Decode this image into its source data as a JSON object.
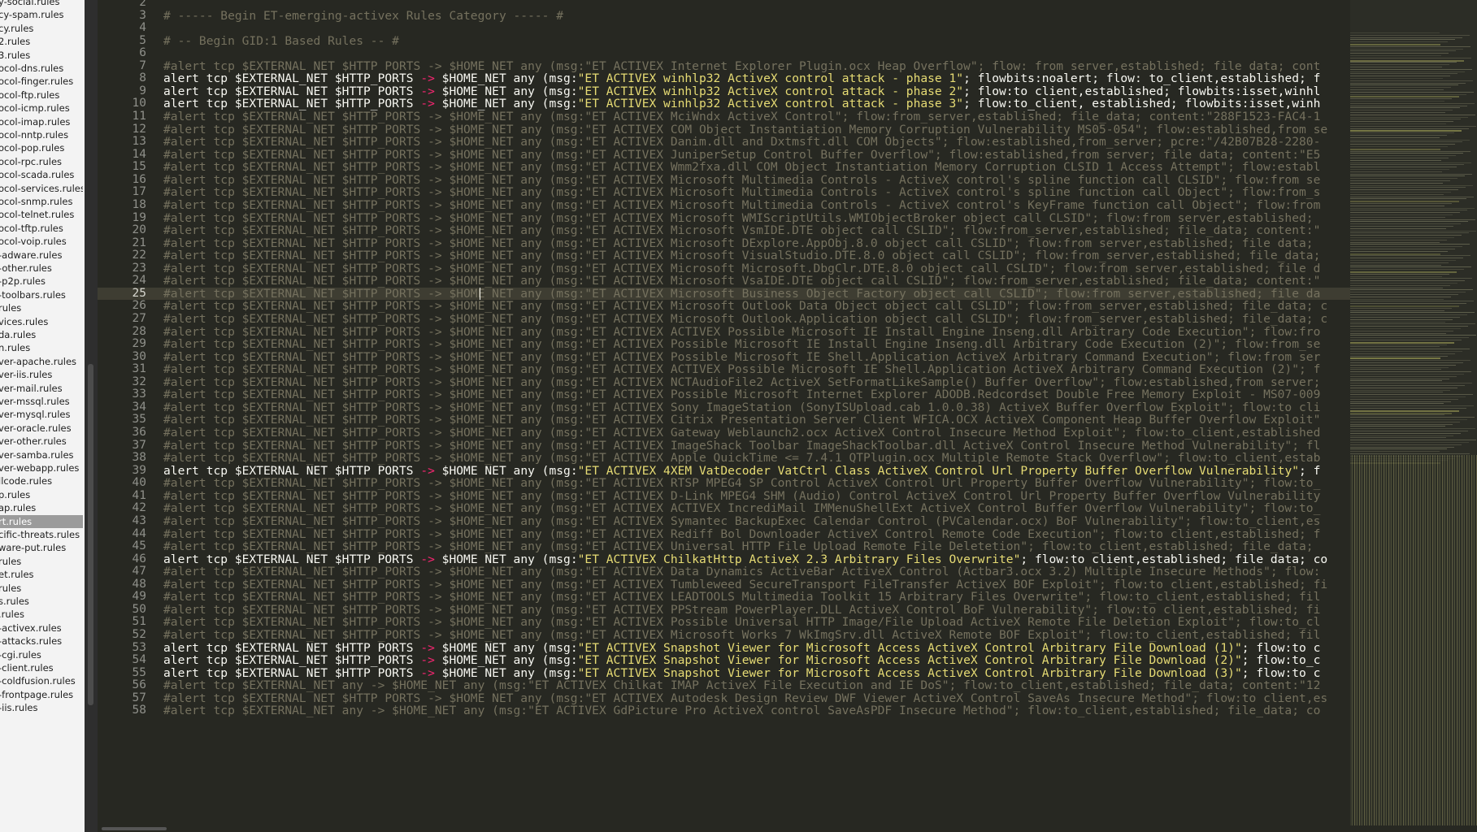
{
  "sidebar": {
    "items": [
      {
        "label": "y-social.rules"
      },
      {
        "label": "cy-spam.rules"
      },
      {
        "label": "cy.rules"
      },
      {
        "label": "2.rules"
      },
      {
        "label": "3.rules"
      },
      {
        "label": "ocol-dns.rules"
      },
      {
        "label": "ocol-finger.rules"
      },
      {
        "label": "ocol-ftp.rules"
      },
      {
        "label": "ocol-icmp.rules"
      },
      {
        "label": "ocol-imap.rules"
      },
      {
        "label": "ocol-nntp.rules"
      },
      {
        "label": "ocol-pop.rules"
      },
      {
        "label": "ocol-rpc.rules"
      },
      {
        "label": "ocol-scada.rules"
      },
      {
        "label": "ocol-services.rules"
      },
      {
        "label": "ocol-snmp.rules"
      },
      {
        "label": "ocol-telnet.rules"
      },
      {
        "label": "ocol-tftp.rules"
      },
      {
        "label": "ocol-voip.rules"
      },
      {
        "label": "-adware.rules"
      },
      {
        "label": "-other.rules"
      },
      {
        "label": "-p2p.rules"
      },
      {
        "label": "-toolbars.rules"
      },
      {
        "label": "rules"
      },
      {
        "label": "vices.rules"
      },
      {
        "label": "da.rules"
      },
      {
        "label": "n.rules"
      },
      {
        "label": "ver-apache.rules"
      },
      {
        "label": "ver-iis.rules"
      },
      {
        "label": "ver-mail.rules"
      },
      {
        "label": "ver-mssql.rules"
      },
      {
        "label": "ver-mysql.rules"
      },
      {
        "label": "ver-oracle.rules"
      },
      {
        "label": "ver-other.rules"
      },
      {
        "label": "ver-samba.rules"
      },
      {
        "label": "ver-webapp.rules"
      },
      {
        "label": "llcode.rules"
      },
      {
        "label": "p.rules"
      },
      {
        "label": "ap.rules"
      },
      {
        "label": "rt.rules",
        "selected": true
      },
      {
        "label": "cific-threats.rules"
      },
      {
        "label": "ware-put.rules"
      },
      {
        "label": "rules"
      },
      {
        "label": "et.rules"
      },
      {
        "label": "rules"
      },
      {
        "label": "s.rules"
      },
      {
        "label": ".rules"
      },
      {
        "label": "-activex.rules"
      },
      {
        "label": "-attacks.rules"
      },
      {
        "label": "-cgi.rules"
      },
      {
        "label": "-client.rules"
      },
      {
        "label": "-coldfusion.rules"
      },
      {
        "label": "-frontpage.rules"
      },
      {
        "label": "-iis.rules"
      }
    ]
  },
  "editor": {
    "active_line": 25,
    "lines": [
      {
        "n": "2",
        "text": "",
        "type": "comment"
      },
      {
        "n": "3",
        "text": "# ----- Begin ET-emerging-activex Rules Category ----- #",
        "type": "comment"
      },
      {
        "n": "4",
        "text": "",
        "type": "comment"
      },
      {
        "n": "5",
        "text": "# -- Begin GID:1 Based Rules -- #",
        "type": "comment"
      },
      {
        "n": "6",
        "text": "",
        "type": "comment"
      },
      {
        "n": "7",
        "text": "#alert tcp $EXTERNAL_NET $HTTP_PORTS -> $HOME_NET any (msg:\"ET ACTIVEX Internet Explorer Plugin.ocx Heap Overflow\"; flow: from_server,established; file_data; cont",
        "type": "comment"
      },
      {
        "n": "8",
        "pre": "alert tcp $EXTERNAL_NET $HTTP_PORTS ",
        "arrow": "->",
        "mid": " $HOME_NET any (msg:",
        "msg": "\"ET ACTIVEX winhlp32 ActiveX control attack - phase 1\"",
        "post": "; flowbits:noalert; flow: to_client,established; f",
        "type": "active"
      },
      {
        "n": "9",
        "pre": "alert tcp $EXTERNAL_NET $HTTP_PORTS ",
        "arrow": "->",
        "mid": " $HOME_NET any (msg:",
        "msg": "\"ET ACTIVEX winhlp32 ActiveX control attack - phase 2\"",
        "post": "; flow:to_client,established; flowbits:isset,winhl",
        "type": "active"
      },
      {
        "n": "10",
        "pre": "alert tcp $EXTERNAL_NET $HTTP_PORTS ",
        "arrow": "->",
        "mid": " $HOME_NET any (msg:",
        "msg": "\"ET ACTIVEX winhlp32 ActiveX control attack - phase 3\"",
        "post": "; flow:to_client, established; flowbits:isset,winh",
        "type": "active"
      },
      {
        "n": "11",
        "text": "#alert tcp $EXTERNAL_NET $HTTP_PORTS -> $HOME_NET any (msg:\"ET ACTIVEX MciWndx ActiveX Control\"; flow:from_server,established; file_data; content:\"288F1523-FAC4-1",
        "type": "comment"
      },
      {
        "n": "12",
        "text": "#alert tcp $EXTERNAL_NET $HTTP_PORTS -> $HOME_NET any (msg:\"ET ACTIVEX COM Object Instantiation Memory Corruption Vulnerability MS05-054\"; flow:established,from_se",
        "type": "comment"
      },
      {
        "n": "13",
        "text": "#alert tcp $EXTERNAL_NET $HTTP_PORTS -> $HOME_NET any (msg:\"ET ACTIVEX Danim.dll and Dxtmsft.dll COM Objects\"; flow:established,from_server; pcre:\"/42B07B28-2280-",
        "type": "comment"
      },
      {
        "n": "14",
        "text": "#alert tcp $EXTERNAL_NET $HTTP_PORTS -> $HOME_NET any (msg:\"ET ACTIVEX JuniperSetup Control Buffer Overflow\"; flow:established,from_server; file_data; content:\"E5",
        "type": "comment"
      },
      {
        "n": "15",
        "text": "#alert tcp $EXTERNAL_NET $HTTP_PORTS -> $HOME_NET any (msg:\"ET ACTIVEX Wmm2fxa.dll COM Object Instantiation Memory Corruption CLSID 1 Access Attempt\"; flow:establ",
        "type": "comment"
      },
      {
        "n": "16",
        "text": "#alert tcp $EXTERNAL_NET $HTTP_PORTS -> $HOME_NET any (msg:\"ET ACTIVEX Microsoft Multimedia Controls - ActiveX control's spline function call CLSID\"; flow:from_se",
        "type": "comment"
      },
      {
        "n": "17",
        "text": "#alert tcp $EXTERNAL_NET $HTTP_PORTS -> $HOME_NET any (msg:\"ET ACTIVEX Microsoft Multimedia Controls - ActiveX control's spline function call Object\"; flow:from_s",
        "type": "comment"
      },
      {
        "n": "18",
        "text": "#alert tcp $EXTERNAL_NET $HTTP_PORTS -> $HOME_NET any (msg:\"ET ACTIVEX Microsoft Multimedia Controls - ActiveX control's KeyFrame function call Object\"; flow:from",
        "type": "comment"
      },
      {
        "n": "19",
        "text": "#alert tcp $EXTERNAL_NET $HTTP_PORTS -> $HOME_NET any (msg:\"ET ACTIVEX Microsoft WMIScriptUtils.WMIObjectBroker object call CLSID\"; flow:from_server,established; ",
        "type": "comment"
      },
      {
        "n": "20",
        "text": "#alert tcp $EXTERNAL_NET $HTTP_PORTS -> $HOME_NET any (msg:\"ET ACTIVEX Microsoft VsmIDE.DTE object call CSLID\"; flow:from_server,established; file_data; content:\"",
        "type": "comment"
      },
      {
        "n": "21",
        "text": "#alert tcp $EXTERNAL_NET $HTTP_PORTS -> $HOME_NET any (msg:\"ET ACTIVEX Microsoft DExplore.AppObj.8.0 object call CSLID\"; flow:from_server,established; file_data;",
        "type": "comment"
      },
      {
        "n": "22",
        "text": "#alert tcp $EXTERNAL_NET $HTTP_PORTS -> $HOME_NET any (msg:\"ET ACTIVEX Microsoft VisualStudio.DTE.8.0 object call CSLID\"; flow:from_server,established; file_data;",
        "type": "comment"
      },
      {
        "n": "23",
        "text": "#alert tcp $EXTERNAL_NET $HTTP_PORTS -> $HOME_NET any (msg:\"ET ACTIVEX Microsoft Microsoft.DbgClr.DTE.8.0 object call CSLID\"; flow:from_server,established; file_d",
        "type": "comment"
      },
      {
        "n": "24",
        "text": "#alert tcp $EXTERNAL_NET $HTTP_PORTS -> $HOME_NET any (msg:\"ET ACTIVEX Microsoft VsaIDE.DTE object call CSLID\"; flow:from_server,established; file_data; content:\"",
        "type": "comment"
      },
      {
        "n": "25",
        "text": "#alert tcp $EXTERNAL_NET $HTTP_PORTS -> $HOME_NET any (msg:\"ET ACTIVEX Microsoft Business Object Factory object call CSLID\"; flow:from_server,established; file_da",
        "type": "comment"
      },
      {
        "n": "26",
        "text": "#alert tcp $EXTERNAL_NET $HTTP_PORTS -> $HOME_NET any (msg:\"ET ACTIVEX Microsoft Outlook Data Object object call CSLID\"; flow:from_server,established; file_data; c",
        "type": "comment"
      },
      {
        "n": "27",
        "text": "#alert tcp $EXTERNAL_NET $HTTP_PORTS -> $HOME_NET any (msg:\"ET ACTIVEX Microsoft Outlook.Application object call CSLID\"; flow:from_server,established; file_data; c",
        "type": "comment"
      },
      {
        "n": "28",
        "text": "#alert tcp $EXTERNAL_NET $HTTP_PORTS -> $HOME_NET any (msg:\"ET ACTIVEX ACTIVEX Possible Microsoft IE Install Engine Inseng.dll Arbitrary Code Execution\"; flow:fro",
        "type": "comment"
      },
      {
        "n": "29",
        "text": "#alert tcp $EXTERNAL_NET $HTTP_PORTS -> $HOME_NET any (msg:\"ET ACTIVEX Possible Microsoft IE Install Engine Inseng.dll Arbitrary Code Execution (2)\"; flow:from_se",
        "type": "comment"
      },
      {
        "n": "30",
        "text": "#alert tcp $EXTERNAL_NET $HTTP_PORTS -> $HOME_NET any (msg:\"ET ACTIVEX Possible Microsoft IE Shell.Application ActiveX Arbitrary Command Execution\"; flow:from_ser",
        "type": "comment"
      },
      {
        "n": "31",
        "text": "#alert tcp $EXTERNAL_NET $HTTP_PORTS -> $HOME_NET any (msg:\"ET ACTIVEX ACTIVEX Possible Microsoft IE Shell.Application ActiveX Arbitrary Command Execution (2)\"; f",
        "type": "comment"
      },
      {
        "n": "32",
        "text": "#alert tcp $EXTERNAL_NET $HTTP_PORTS -> $HOME_NET any (msg:\"ET ACTIVEX NCTAudioFile2 ActiveX SetFormatLikeSample() Buffer Overflow\"; flow:established,from_server; ",
        "type": "comment"
      },
      {
        "n": "33",
        "text": "#alert tcp $EXTERNAL_NET $HTTP_PORTS -> $HOME_NET any (msg:\"ET ACTIVEX Possible Microsoft Internet Explorer ADODB.Redcordset Double Free Memory Exploit - MS07-009",
        "type": "comment"
      },
      {
        "n": "34",
        "text": "#alert tcp $EXTERNAL_NET $HTTP_PORTS -> $HOME_NET any (msg:\"ET ACTIVEX Sony ImageStation (SonyISUpload.cab 1.0.0.38) ActiveX Buffer Overflow Exploit\"; flow:to_cli",
        "type": "comment"
      },
      {
        "n": "35",
        "text": "#alert tcp $EXTERNAL_NET $HTTP_PORTS -> $HOME_NET any (msg:\"ET ACTIVEX Citrix Presentation Server Client WFICA.OCX ActiveX Component Heap Buffer Overflow Exploit\"",
        "type": "comment"
      },
      {
        "n": "36",
        "text": "#alert tcp $EXTERNAL_NET $HTTP_PORTS -> $HOME_NET any (msg:\"ET ACTIVEX Gateway Weblaunch2.ocx ActiveX Control Insecure Method Exploit\"; flow:to_client,established",
        "type": "comment"
      },
      {
        "n": "37",
        "text": "#alert tcp $EXTERNAL_NET $HTTP_PORTS -> $HOME_NET any (msg:\"ET ACTIVEX ImageShack Toolbar ImageShackToolbar.dll ActiveX Control Insecure Method Vulnerability\"; fl",
        "type": "comment"
      },
      {
        "n": "38",
        "text": "#alert tcp $EXTERNAL_NET $HTTP_PORTS -> $HOME_NET any (msg:\"ET ACTIVEX Apple QuickTime <= 7.4.1 QTPlugin.ocx Multiple Remote Stack Overflow\"; flow:to_client,estab",
        "type": "comment"
      },
      {
        "n": "39",
        "pre": "alert tcp $EXTERNAL_NET $HTTP_PORTS ",
        "arrow": "->",
        "mid": " $HOME_NET any (msg:",
        "msg": "\"ET ACTIVEX 4XEM VatDecoder VatCtrl Class ActiveX Control Url Property Buffer Overflow Vulnerability\"",
        "post": "; f",
        "type": "active"
      },
      {
        "n": "40",
        "text": "#alert tcp $EXTERNAL_NET $HTTP_PORTS -> $HOME_NET any (msg:\"ET ACTIVEX RTSP MPEG4 SP Control ActiveX Control Url Property Buffer Overflow Vulnerability\"; flow:to_",
        "type": "comment"
      },
      {
        "n": "41",
        "text": "#alert tcp $EXTERNAL_NET $HTTP_PORTS -> $HOME_NET any (msg:\"ET ACTIVEX D-Link MPEG4 SHM (Audio) Control ActiveX Control Url Property Buffer Overflow Vulnerability",
        "type": "comment"
      },
      {
        "n": "42",
        "text": "#alert tcp $EXTERNAL_NET $HTTP_PORTS -> $HOME_NET any (msg:\"ET ACTIVEX ACTIVEX IncrediMail IMMenuShellExt ActiveX Control Buffer Overflow Vulnerability\"; flow:to_",
        "type": "comment"
      },
      {
        "n": "43",
        "text": "#alert tcp $EXTERNAL_NET $HTTP_PORTS -> $HOME_NET any (msg:\"ET ACTIVEX Symantec BackupExec Calendar Control (PVCalendar.ocx) BoF Vulnerability\"; flow:to_client,es",
        "type": "comment"
      },
      {
        "n": "44",
        "text": "#alert tcp $EXTERNAL_NET $HTTP_PORTS -> $HOME_NET any (msg:\"ET ACTIVEX Rediff Bol Downloader ActiveX Control Remote Code Execution\"; flow:to_client,established; f",
        "type": "comment"
      },
      {
        "n": "45",
        "text": "#alert tcp $EXTERNAL_NET $HTTP_PORTS -> $HOME_NET any (msg:\"ET ACTIVEX Universal HTTP File Upload Remote File Deletetion\"; flow:to_client,established; file_data; ",
        "type": "comment"
      },
      {
        "n": "46",
        "pre": "alert tcp $EXTERNAL_NET $HTTP_PORTS ",
        "arrow": "->",
        "mid": " $HOME_NET any (msg:",
        "msg": "\"ET ACTIVEX ChilkatHttp ActiveX 2.3 Arbitrary Files Overwrite\"",
        "post": "; flow:to_client,established; file_data; co",
        "type": "active"
      },
      {
        "n": "47",
        "text": "#alert tcp $EXTERNAL_NET $HTTP_PORTS -> $HOME_NET any (msg:\"ET ACTIVEX Data Dynamics ActiveBar ActiveX Control (Actbar3.ocx 3.2) Multiple Insecure Methods\"; flow:",
        "type": "comment"
      },
      {
        "n": "48",
        "text": "#alert tcp $EXTERNAL_NET $HTTP_PORTS -> $HOME_NET any (msg:\"ET ACTIVEX Tumbleweed SecureTransport FileTransfer ActiveX BOF Exploit\"; flow:to_client,established; fi",
        "type": "comment"
      },
      {
        "n": "49",
        "text": "#alert tcp $EXTERNAL_NET $HTTP_PORTS -> $HOME_NET any (msg:\"ET ACTIVEX LEADTOOLS Multimedia Toolkit 15 Arbitrary Files Overwrite\"; flow:to_client,established; fil",
        "type": "comment"
      },
      {
        "n": "50",
        "text": "#alert tcp $EXTERNAL_NET $HTTP_PORTS -> $HOME_NET any (msg:\"ET ACTIVEX PPStream PowerPlayer.DLL ActiveX Control BoF Vulnerability\"; flow:to_client,established; fi",
        "type": "comment"
      },
      {
        "n": "51",
        "text": "#alert tcp $EXTERNAL_NET $HTTP_PORTS -> $HOME_NET any (msg:\"ET ACTIVEX Possible Universal HTTP Image/File Upload ActiveX Remote File Deletion Exploit\"; flow:to_cl",
        "type": "comment"
      },
      {
        "n": "52",
        "text": "#alert tcp $EXTERNAL_NET $HTTP_PORTS -> $HOME_NET any (msg:\"ET ACTIVEX Microsoft Works 7 WkImgSrv.dll ActiveX Remote BOF Exploit\"; flow:to_client,established; fil",
        "type": "comment"
      },
      {
        "n": "53",
        "pre": "alert tcp $EXTERNAL_NET $HTTP_PORTS ",
        "arrow": "->",
        "mid": " $HOME_NET any (msg:",
        "msg": "\"ET ACTIVEX Snapshot Viewer for Microsoft Access ActiveX Control Arbitrary File Download (1)\"",
        "post": "; flow:to_c",
        "type": "active"
      },
      {
        "n": "54",
        "pre": "alert tcp $EXTERNAL_NET $HTTP_PORTS ",
        "arrow": "->",
        "mid": " $HOME_NET any (msg:",
        "msg": "\"ET ACTIVEX Snapshot Viewer for Microsoft Access ActiveX Control Arbitrary File Download (2)\"",
        "post": "; flow:to_c",
        "type": "active"
      },
      {
        "n": "55",
        "pre": "alert tcp $EXTERNAL_NET $HTTP_PORTS ",
        "arrow": "->",
        "mid": " $HOME_NET any (msg:",
        "msg": "\"ET ACTIVEX Snapshot Viewer for Microsoft Access ActiveX Control Arbitrary File Download (3)\"",
        "post": "; flow:to_c",
        "type": "active"
      },
      {
        "n": "56",
        "text": "#alert tcp $EXTERNAL_NET any -> $HOME_NET any (msg:\"ET ACTIVEX Chilkat IMAP ActiveX File Execution and IE DoS\"; flow:to_client,established; file_data; content:\"12",
        "type": "comment"
      },
      {
        "n": "57",
        "text": "#alert tcp $EXTERNAL_NET $HTTP_PORTS -> $HOME_NET any (msg:\"ET ACTIVEX Autodesk Design Review DWF Viewer ActiveX Control SaveAs Insecure Method\"; flow:to_client,es",
        "type": "comment"
      },
      {
        "n": "58",
        "text": "#alert tcp $EXTERNAL_NET any -> $HOME_NET any (msg:\"ET ACTIVEX GdPicture Pro ActiveX control SaveAsPDF Insecure Method\"; flow:to_client,established; file_data; co",
        "type": "comment"
      }
    ]
  },
  "colors": {
    "background": "#272822",
    "comment": "#75715e",
    "text": "#f8f8f2",
    "keyword": "#f92672",
    "string": "#e6db74",
    "sidebar_bg": "#f3f3f3",
    "sidebar_selected": "#9b9b9b"
  }
}
